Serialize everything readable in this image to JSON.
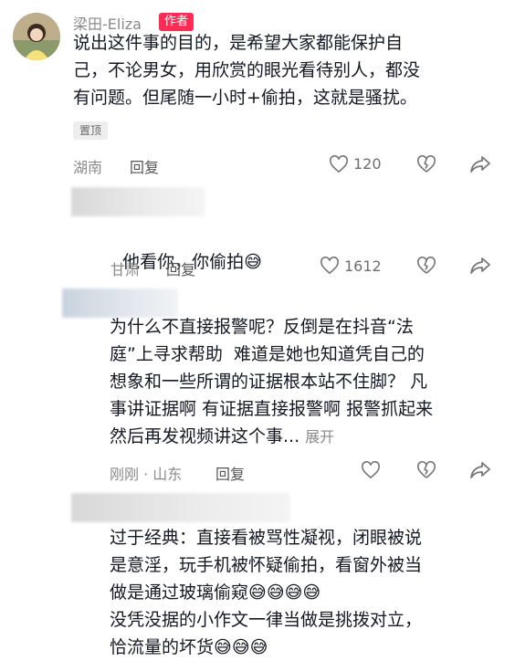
{
  "comment1": {
    "author": "梁田-Eliza",
    "author_badge": "作者",
    "text": "说出这件事的目的，是希望大家都能保护自\n己，不论男女，用欣赏的眼光看待别人，都没\n有问题。但尾随一小时+偷拍，这就是骚扰。",
    "pin_label": "置顶",
    "location": "湖南",
    "reply_label": "回复",
    "like_count": "120"
  },
  "comment2": {
    "text": "他看你，你偷拍",
    "emoji": "😅",
    "location": "甘肃",
    "reply_label": "回复",
    "like_count": "1612"
  },
  "comment3": {
    "text": "为什么不直接报警呢？反倒是在抖音“法\n庭”上寻求帮助  难道是她也知道凭自己的\n想象和一些所谓的证据根本站不住脚？ 凡\n事讲证据啊 有证据直接报警啊 报警抓起来\n然后再发视频讲这个事...",
    "expand_label": "展开",
    "location": "刚刚 · 山东",
    "reply_label": "回复"
  },
  "comment4": {
    "line1": "过于经典：直接看被骂性凝视，闭眼被说",
    "line2": "是意淫，玩手机被怀疑偷拍，看窗外被当",
    "line3": "做是通过玻璃偷窥",
    "line3_emoji": "😅😅😅😅",
    "line4": "没凭没据的小作文一律当做是挑拨对立，",
    "line5": "恰流量的坏货",
    "line5_emoji": "😅😅😅"
  },
  "icons": {
    "like": "heart-outline-icon",
    "dislike": "broken-heart-icon",
    "share": "share-arrow-icon"
  }
}
